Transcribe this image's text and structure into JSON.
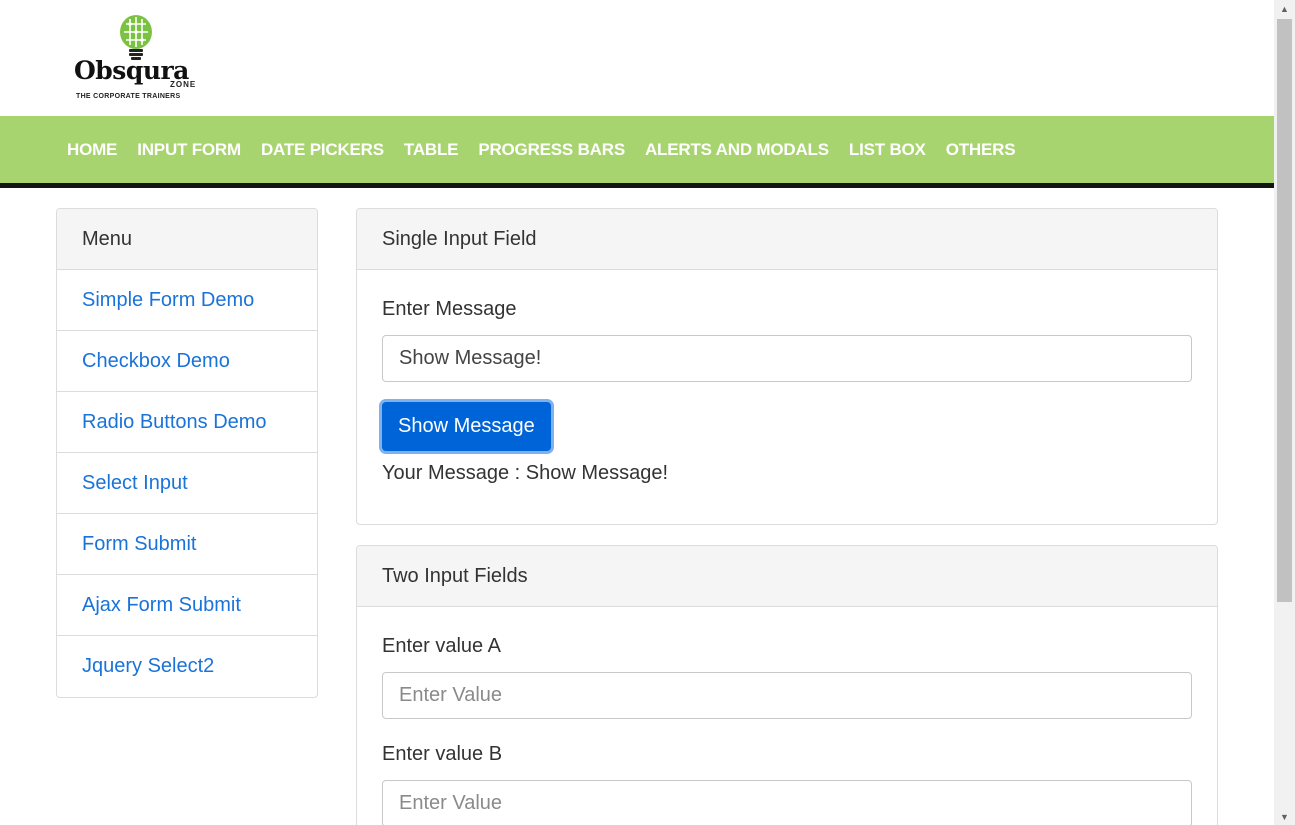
{
  "logo": {
    "brand": "Obsqura",
    "sub": "ZONE",
    "tagline": "THE CORPORATE TRAINERS"
  },
  "nav": {
    "items": [
      "HOME",
      "INPUT FORM",
      "DATE PICKERS",
      "TABLE",
      "PROGRESS BARS",
      "ALERTS AND MODALS",
      "LIST BOX",
      "OTHERS"
    ]
  },
  "sidebar": {
    "title": "Menu",
    "items": [
      "Simple Form Demo",
      "Checkbox Demo",
      "Radio Buttons Demo",
      "Select Input",
      "Form Submit",
      "Ajax Form Submit",
      "Jquery Select2"
    ]
  },
  "single_input": {
    "title": "Single Input Field",
    "label": "Enter Message",
    "value": "Show Message!",
    "button_label": "Show Message",
    "output_text": "Your Message : Show Message!"
  },
  "two_inputs": {
    "title": "Two Input Fields",
    "label_a": "Enter value A",
    "placeholder_a": "Enter Value",
    "label_b": "Enter value B",
    "placeholder_b": "Enter Value"
  },
  "colors": {
    "navbar": "#a8d46f",
    "link": "#1a73d9",
    "button": "#0064d9",
    "logo_bulb": "#7cc242"
  },
  "icons": {
    "logo": "lightbulb-brain-icon",
    "scroll_up": "triangle-up-icon",
    "scroll_down": "triangle-down-icon"
  }
}
